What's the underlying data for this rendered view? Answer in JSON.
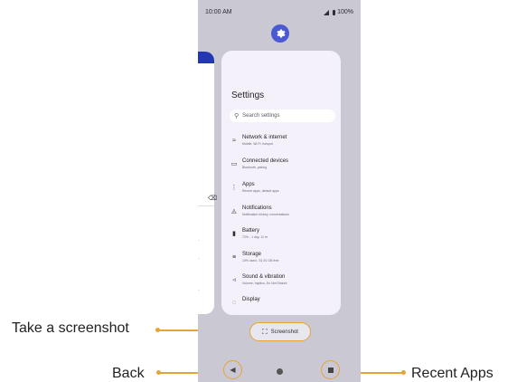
{
  "status": {
    "time": "10:00 AM",
    "battery": "100%"
  },
  "settings": {
    "title": "Settings",
    "search_placeholder": "Search settings",
    "items": [
      {
        "icon": "wifi-icon",
        "title": "Network & internet",
        "subtitle": "Mobile, Wi-Fi, hotspot"
      },
      {
        "icon": "devices-icon",
        "title": "Connected devices",
        "subtitle": "Bluetooth, pairing"
      },
      {
        "icon": "apps-icon",
        "title": "Apps",
        "subtitle": "Recent apps, default apps"
      },
      {
        "icon": "bell-icon",
        "title": "Notifications",
        "subtitle": "Notification history, conversations"
      },
      {
        "icon": "battery-icon",
        "title": "Battery",
        "subtitle": "72% - 1 day, 11 hr"
      },
      {
        "icon": "storage-icon",
        "title": "Storage",
        "subtitle": "19% used - 51.91 GB free"
      },
      {
        "icon": "sound-icon",
        "title": "Sound & vibration",
        "subtitle": "Volume, haptics, Do Not Disturb"
      },
      {
        "icon": "display-icon",
        "title": "Display",
        "subtitle": ""
      }
    ]
  },
  "screenshot_button": {
    "label": "Screenshot"
  },
  "callouts": {
    "screenshot": "Take a screenshot",
    "back": "Back",
    "recent_apps": "Recent Apps"
  },
  "colors": {
    "accent": "#e7a436",
    "card": "#f4f1fa",
    "screen_bg": "#c9c8d3",
    "prev_topbar": "#2336b6"
  }
}
